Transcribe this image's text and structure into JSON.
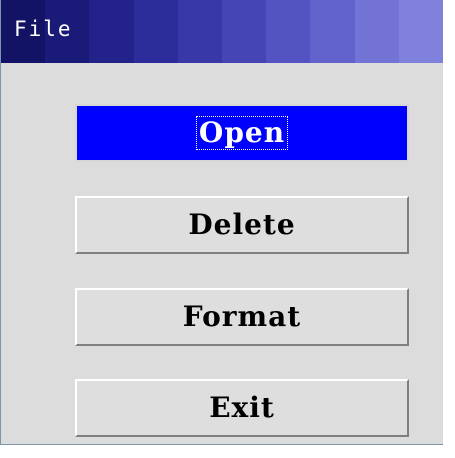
{
  "window": {
    "title": "File",
    "title_gradient": [
      "#131366",
      "#1a1a78",
      "#22228a",
      "#2c2c9a",
      "#3838a8",
      "#4545b6",
      "#5353c2",
      "#6262cd",
      "#7373d6",
      "#8080dd"
    ]
  },
  "menu": {
    "buttons": [
      {
        "label": "Open",
        "selected": true
      },
      {
        "label": "Delete",
        "selected": false
      },
      {
        "label": "Format",
        "selected": false
      },
      {
        "label": "Exit",
        "selected": false
      }
    ]
  },
  "colors": {
    "dialog_background": "#dcdcdc",
    "selected_background": "#0000ff",
    "selected_text": "#ffffff",
    "button_text": "#000000"
  }
}
